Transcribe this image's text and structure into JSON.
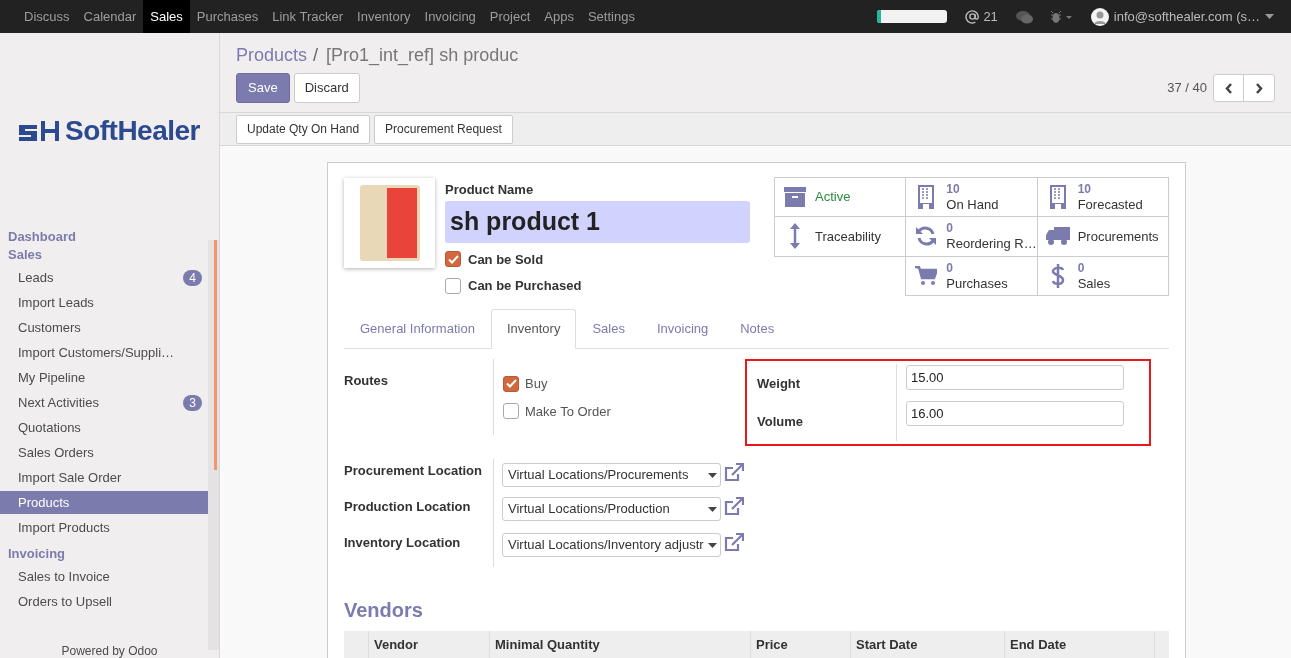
{
  "top_menu": [
    {
      "label": "Discuss",
      "selected": false
    },
    {
      "label": "Calendar",
      "selected": false
    },
    {
      "label": "Sales",
      "selected": true
    },
    {
      "label": "Purchases",
      "selected": false
    },
    {
      "label": "Link Tracker",
      "selected": false
    },
    {
      "label": "Inventory",
      "selected": false
    },
    {
      "label": "Invoicing",
      "selected": false
    },
    {
      "label": "Project",
      "selected": false
    },
    {
      "label": "Apps",
      "selected": false
    },
    {
      "label": "Settings",
      "selected": false
    }
  ],
  "systray": {
    "progress": {
      "level": 0.05
    },
    "mentions": "21",
    "user": "info@softhealer.com (s…"
  },
  "logo": {
    "text": "SoftHealer"
  },
  "sidebar": {
    "groups": [
      {
        "title": "Dashboard"
      },
      {
        "title": "Sales",
        "items": [
          {
            "label": "Leads",
            "badge": "4",
            "selected": false
          },
          {
            "label": "Import Leads",
            "selected": false
          },
          {
            "label": "Customers",
            "selected": false
          },
          {
            "label": "Import Customers/Suppli…",
            "selected": false
          },
          {
            "label": "My Pipeline",
            "selected": false
          },
          {
            "label": "Next Activities",
            "badge": "3",
            "selected": false
          },
          {
            "label": "Quotations",
            "selected": false
          },
          {
            "label": "Sales Orders",
            "selected": false
          },
          {
            "label": "Import Sale Order",
            "selected": false
          },
          {
            "label": "Products",
            "selected": true
          },
          {
            "label": "Import Products",
            "selected": false
          }
        ]
      },
      {
        "title": "Invoicing",
        "items": [
          {
            "label": "Sales to Invoice",
            "selected": false
          },
          {
            "label": "Orders to Upsell",
            "selected": false
          }
        ]
      }
    ],
    "footer": "Powered by Odoo"
  },
  "breadcrumb": {
    "parent": "Products",
    "separator": "/",
    "current": "[Pro1_int_ref] sh produc"
  },
  "buttons": [
    "Save",
    "Discard"
  ],
  "pager": "37 / 40",
  "header_buttons": [
    "Update Qty On Hand",
    "Procurement Request"
  ],
  "product": {
    "name_label": "Product Name",
    "name": "sh product 1",
    "options": [
      {
        "label": "Can be Sold",
        "checked": true
      },
      {
        "label": "Can be Purchased",
        "checked": false
      }
    ]
  },
  "smart_buttons": [
    {
      "kind": "toggle",
      "label": "Active",
      "active": true
    },
    {
      "kind": "stat",
      "value": "10",
      "label": "On Hand"
    },
    {
      "kind": "stat",
      "value": "10",
      "label": "Forecasted"
    },
    {
      "kind": "action",
      "label": "Traceability"
    },
    {
      "kind": "stat",
      "value": "0",
      "label": "Reordering R…"
    },
    {
      "kind": "action",
      "label": "Procurements"
    },
    {
      "kind": "empty"
    },
    {
      "kind": "stat",
      "value": "0",
      "label": "Purchases"
    },
    {
      "kind": "stat",
      "value": "0",
      "label": "Sales"
    }
  ],
  "tabs": [
    {
      "label": "General Information",
      "selected": false
    },
    {
      "label": "Inventory",
      "selected": true
    },
    {
      "label": "Sales",
      "selected": false
    },
    {
      "label": "Invoicing",
      "selected": false
    },
    {
      "label": "Notes",
      "selected": false
    }
  ],
  "routes": {
    "label": "Routes",
    "options": [
      {
        "label": "Buy",
        "checked": true
      },
      {
        "label": "Make To Order",
        "checked": false
      }
    ]
  },
  "measures": [
    {
      "label": "Weight",
      "value": "15.00"
    },
    {
      "label": "Volume",
      "value": "16.00"
    }
  ],
  "locations": [
    {
      "label": "Procurement Location",
      "value": "Virtual Locations/Procurements"
    },
    {
      "label": "Production Location",
      "value": "Virtual Locations/Production"
    },
    {
      "label": "Inventory Location",
      "value": "Virtual Locations/Inventory adjustr"
    }
  ],
  "vendors": {
    "title": "Vendors",
    "columns": [
      "Vendor",
      "Minimal Quantity",
      "Price",
      "Start Date",
      "End Date"
    ]
  }
}
